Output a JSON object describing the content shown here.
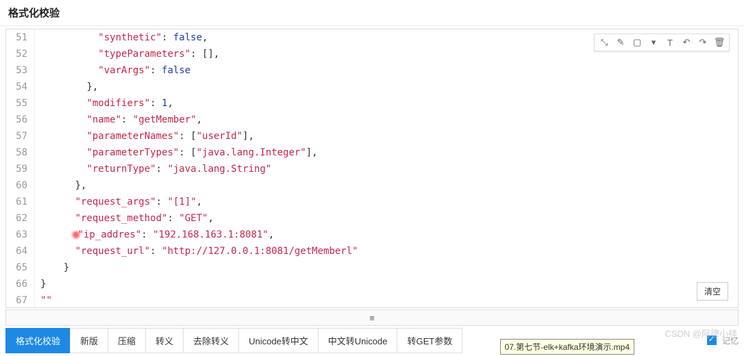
{
  "header": {
    "title": "格式化校验"
  },
  "toolbar_icons": [
    "cursor",
    "edit",
    "rect",
    "dropdown",
    "text",
    "undo",
    "redo",
    "trash"
  ],
  "code_lines": [
    {
      "n": 51,
      "indent": 10,
      "tokens": [
        {
          "t": "k",
          "v": "\"synthetic\""
        },
        {
          "t": "p",
          "v": ": "
        },
        {
          "t": "v",
          "v": "false"
        },
        {
          "t": "p",
          "v": ","
        }
      ]
    },
    {
      "n": 52,
      "indent": 10,
      "tokens": [
        {
          "t": "k",
          "v": "\"typeParameters\""
        },
        {
          "t": "p",
          "v": ": []"
        },
        {
          "t": "p",
          "v": ","
        }
      ]
    },
    {
      "n": 53,
      "indent": 10,
      "tokens": [
        {
          "t": "k",
          "v": "\"varArgs\""
        },
        {
          "t": "p",
          "v": ": "
        },
        {
          "t": "v",
          "v": "false"
        }
      ]
    },
    {
      "n": 54,
      "indent": 8,
      "tokens": [
        {
          "t": "p",
          "v": "},"
        }
      ]
    },
    {
      "n": 55,
      "indent": 8,
      "tokens": [
        {
          "t": "k",
          "v": "\"modifiers\""
        },
        {
          "t": "p",
          "v": ": "
        },
        {
          "t": "v",
          "v": "1"
        },
        {
          "t": "p",
          "v": ","
        }
      ]
    },
    {
      "n": 56,
      "indent": 8,
      "tokens": [
        {
          "t": "k",
          "v": "\"name\""
        },
        {
          "t": "p",
          "v": ": "
        },
        {
          "t": "s",
          "v": "\"getMember\""
        },
        {
          "t": "p",
          "v": ","
        }
      ]
    },
    {
      "n": 57,
      "indent": 8,
      "tokens": [
        {
          "t": "k",
          "v": "\"parameterNames\""
        },
        {
          "t": "p",
          "v": ": ["
        },
        {
          "t": "s",
          "v": "\"userId\""
        },
        {
          "t": "p",
          "v": "],"
        }
      ]
    },
    {
      "n": 58,
      "indent": 8,
      "tokens": [
        {
          "t": "k",
          "v": "\"parameterTypes\""
        },
        {
          "t": "p",
          "v": ": ["
        },
        {
          "t": "s",
          "v": "\"java.lang.Integer\""
        },
        {
          "t": "p",
          "v": "],"
        }
      ]
    },
    {
      "n": 59,
      "indent": 8,
      "tokens": [
        {
          "t": "k",
          "v": "\"returnType\""
        },
        {
          "t": "p",
          "v": ": "
        },
        {
          "t": "s",
          "v": "\"java.lang.String\""
        }
      ]
    },
    {
      "n": 60,
      "indent": 6,
      "tokens": [
        {
          "t": "p",
          "v": "},"
        }
      ]
    },
    {
      "n": 61,
      "indent": 6,
      "tokens": [
        {
          "t": "k",
          "v": "\"request_args\""
        },
        {
          "t": "p",
          "v": ": "
        },
        {
          "t": "s",
          "v": "\"[1]\""
        },
        {
          "t": "p",
          "v": ","
        }
      ]
    },
    {
      "n": 62,
      "indent": 6,
      "tokens": [
        {
          "t": "k",
          "v": "\"request_method\""
        },
        {
          "t": "p",
          "v": ": "
        },
        {
          "t": "s",
          "v": "\"GET\""
        },
        {
          "t": "p",
          "v": ","
        }
      ]
    },
    {
      "n": 63,
      "indent": 6,
      "hl": true,
      "tokens": [
        {
          "t": "k",
          "v": "\"ip_addres\""
        },
        {
          "t": "p",
          "v": ": "
        },
        {
          "t": "s",
          "v": "\"192.168.163.1:8081\""
        },
        {
          "t": "p",
          "v": ","
        }
      ]
    },
    {
      "n": 64,
      "indent": 6,
      "tokens": [
        {
          "t": "k",
          "v": "\"request_url\""
        },
        {
          "t": "p",
          "v": ": "
        },
        {
          "t": "s",
          "v": "\"http://127.0.0.1:8081/getMemberl\""
        }
      ]
    },
    {
      "n": 65,
      "indent": 4,
      "tokens": [
        {
          "t": "p",
          "v": "}"
        }
      ]
    },
    {
      "n": 66,
      "indent": 0,
      "tokens": [
        {
          "t": "p",
          "v": "}"
        }
      ]
    },
    {
      "n": 67,
      "indent": 0,
      "tokens": [
        {
          "t": "s",
          "v": "\"\""
        }
      ]
    }
  ],
  "clear_btn": "清空",
  "buttons": [
    {
      "label": "格式化校验",
      "primary": true
    },
    {
      "label": "新版"
    },
    {
      "label": "压缩"
    },
    {
      "label": "转义"
    },
    {
      "label": "去除转义"
    },
    {
      "label": "Unicode转中文"
    },
    {
      "label": "中文转Unicode"
    },
    {
      "label": "转GET参数"
    }
  ],
  "checkbox_label": "记忆",
  "watermark": "CSDN @阿德小祥",
  "tooltip": "07.第七节-elk+kafka环境演示.mp4"
}
